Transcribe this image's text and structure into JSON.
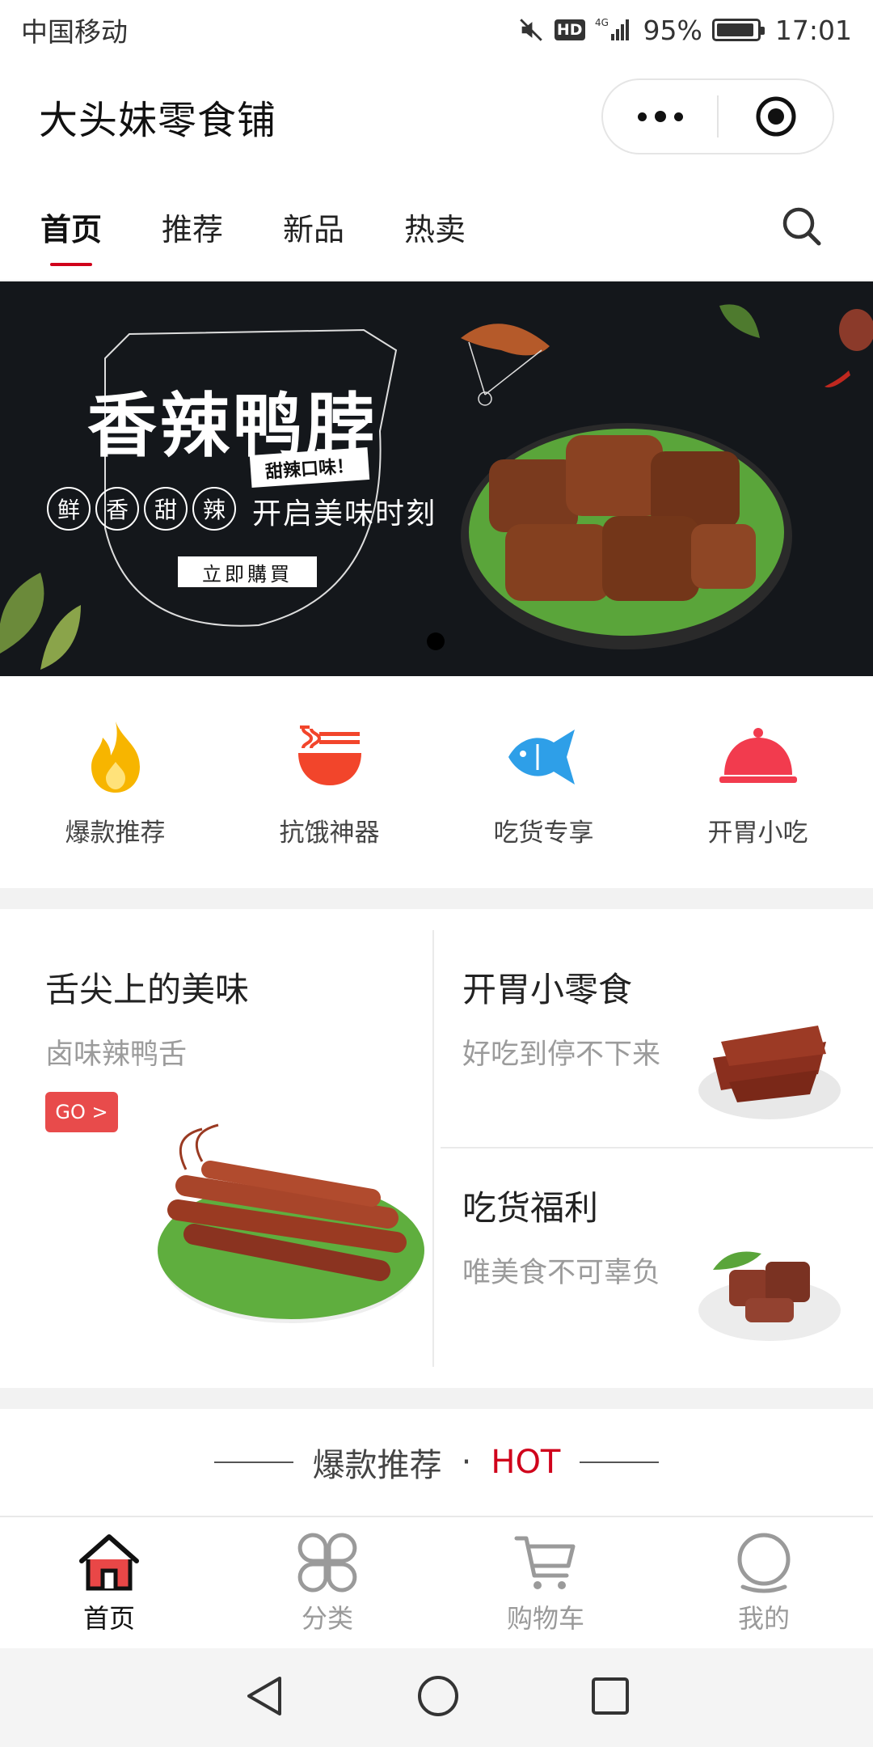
{
  "status_bar": {
    "carrier": "中国移动",
    "hd": "HD",
    "network": "4G",
    "battery": "95%",
    "battery_level": 0.95,
    "time": "17:01"
  },
  "header": {
    "title": "大头妹零食铺"
  },
  "tabs": [
    {
      "label": "首页",
      "active": true
    },
    {
      "label": "推荐",
      "active": false
    },
    {
      "label": "新品",
      "active": false
    },
    {
      "label": "热卖",
      "active": false
    }
  ],
  "banner": {
    "title": "香辣鸭脖",
    "tag": "甜辣口味！",
    "circle_chars": [
      "鲜",
      "香",
      "甜",
      "辣"
    ],
    "slogan": "开启美味时刻",
    "cta": "立即購買"
  },
  "categories": [
    {
      "label": "爆款推荐",
      "icon": "flame-icon",
      "color": "#f7b500"
    },
    {
      "label": "抗饿神器",
      "icon": "noodle-bowl-icon",
      "color": "#f2452b"
    },
    {
      "label": "吃货专享",
      "icon": "fish-icon",
      "color": "#2e9fe8"
    },
    {
      "label": "开胃小吃",
      "icon": "cloche-icon",
      "color": "#f23b4e"
    }
  ],
  "promos": {
    "left": {
      "title": "舌尖上的美味",
      "subtitle": "卤味辣鸭舌",
      "go": "GO >"
    },
    "right_top": {
      "title": "开胃小零食",
      "subtitle": "好吃到停不下来"
    },
    "right_bottom": {
      "title": "吃货福利",
      "subtitle": "唯美食不可辜负"
    }
  },
  "section": {
    "title": "爆款推荐",
    "dot": "·",
    "hot": "HOT"
  },
  "bottom_nav": [
    {
      "label": "首页",
      "icon": "home-icon",
      "active": true
    },
    {
      "label": "分类",
      "icon": "category-icon",
      "active": false
    },
    {
      "label": "购物车",
      "icon": "cart-icon",
      "active": false
    },
    {
      "label": "我的",
      "icon": "profile-icon",
      "active": false
    }
  ],
  "colors": {
    "accent": "#d0021b",
    "go_button": "#e84b4b",
    "banner_bg": "#14171b",
    "divider": "#f2f2f2"
  }
}
